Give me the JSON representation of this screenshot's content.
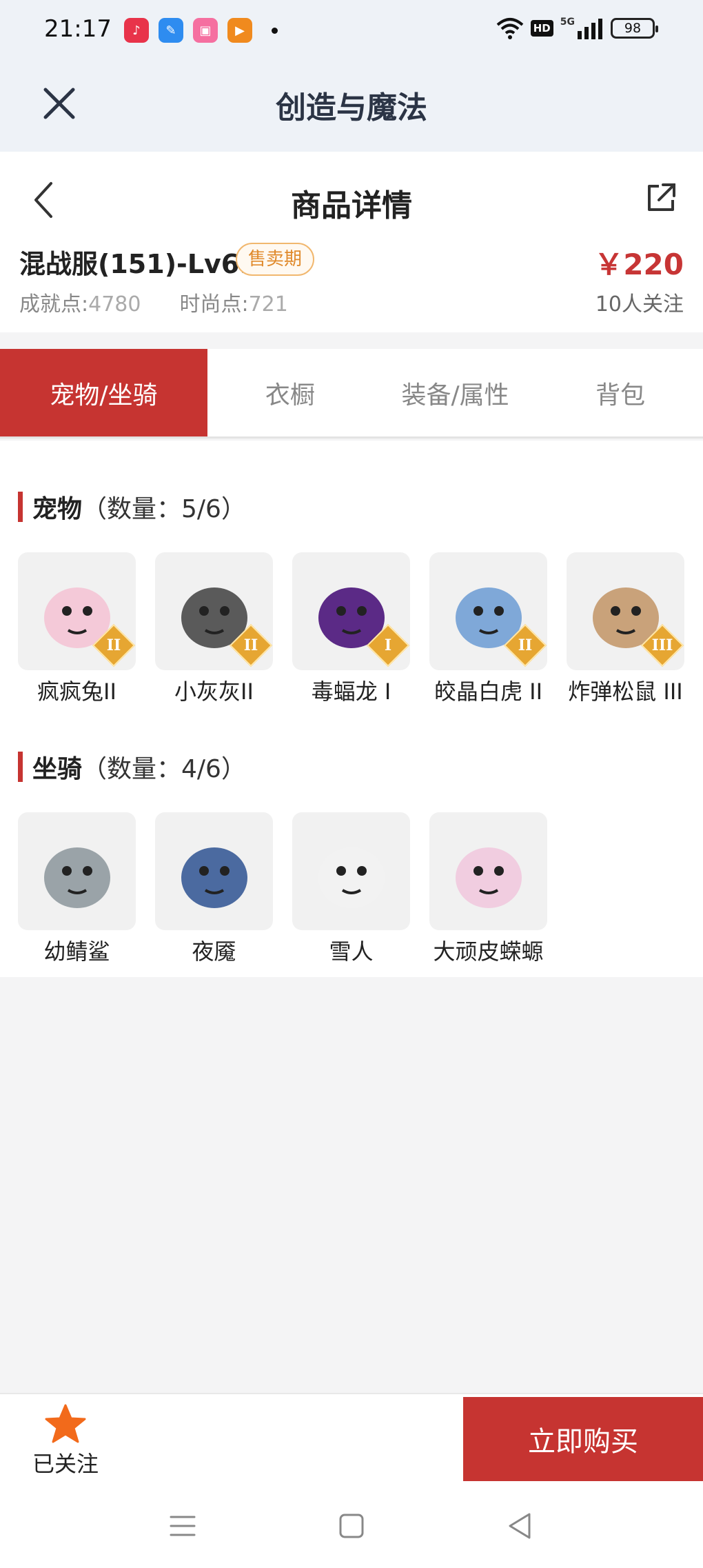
{
  "status_bar": {
    "time": "21:17",
    "hd_label": "HD",
    "network_label": "5G",
    "battery": "98",
    "apps": [
      {
        "icon": "music-app-icon",
        "color": "#e8334a"
      },
      {
        "icon": "feather-app-icon",
        "color": "#2e8cf0"
      },
      {
        "icon": "bilibili-app-icon",
        "color": "#f56fa0"
      },
      {
        "icon": "video-app-icon",
        "color": "#f08a1e"
      }
    ]
  },
  "app_bar": {
    "title": "创造与魔法"
  },
  "product": {
    "nav_title": "商品详情",
    "name": "混战服(151)-Lv69",
    "badge": "售卖期",
    "price": "￥220",
    "stats": [
      {
        "label": "成就点:",
        "value": "4780"
      },
      {
        "label": "时尚点:",
        "value": "721"
      }
    ],
    "followers": "10人关注"
  },
  "tabs": [
    {
      "label": "宠物/坐骑",
      "active": true
    },
    {
      "label": "衣橱",
      "active": false
    },
    {
      "label": "装备/属性",
      "active": false
    },
    {
      "label": "背包",
      "active": false
    }
  ],
  "pets": {
    "title": "宠物",
    "count": "（数量：5/6）",
    "items": [
      {
        "name": "疯疯兔II",
        "tier": "II",
        "icon": "pink-rabbit-icon",
        "color": "#f4c9d8"
      },
      {
        "name": "小灰灰II",
        "tier": "II",
        "icon": "gray-wolf-icon",
        "color": "#5a5a5a"
      },
      {
        "name": "毒蝠龙 I",
        "tier": "I",
        "icon": "purple-dragon-icon",
        "color": "#5b2a86"
      },
      {
        "name": "皎晶白虎 II",
        "tier": "II",
        "icon": "white-tiger-icon",
        "color": "#7fa8d8"
      },
      {
        "name": "炸弹松鼠 III",
        "tier": "III",
        "icon": "squirrel-icon",
        "color": "#c9a27a"
      }
    ]
  },
  "mounts": {
    "title": "坐骑",
    "count": "（数量：4/6）",
    "items": [
      {
        "name": "幼鲭鲨",
        "icon": "shark-icon",
        "color": "#9aa3a8"
      },
      {
        "name": "夜魇",
        "icon": "night-horse-icon",
        "color": "#4b6aa0"
      },
      {
        "name": "雪人",
        "icon": "snowman-icon",
        "color": "#f2f2f2"
      },
      {
        "name": "大顽皮蝾螈",
        "icon": "axolotl-icon",
        "color": "#f1cde0"
      }
    ]
  },
  "bottom_bar": {
    "follow_label": "已关注",
    "buy_label": "立即购买"
  }
}
